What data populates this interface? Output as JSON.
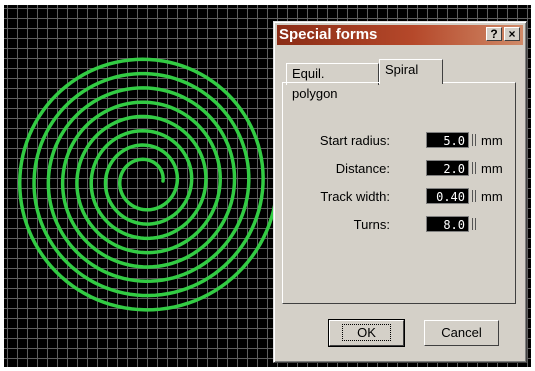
{
  "dialog": {
    "title": "Special forms",
    "help_btn": "?",
    "close_btn": "×"
  },
  "tabs": [
    {
      "label": "Equil. polygon"
    },
    {
      "label": "Spiral"
    }
  ],
  "fields": [
    {
      "label": "Start radius:",
      "value": "5.0",
      "unit": "mm"
    },
    {
      "label": "Distance:",
      "value": "2.0",
      "unit": "mm"
    },
    {
      "label": "Track width:",
      "value": "0.40",
      "unit": "mm"
    },
    {
      "label": "Turns:",
      "value": "8.0",
      "unit": ""
    }
  ],
  "buttons": {
    "ok": "OK",
    "cancel": "Cancel"
  },
  "colors": {
    "spiral": "#33cc44",
    "grid": "#5f5f5f",
    "titlebar": "#8a2c16"
  }
}
